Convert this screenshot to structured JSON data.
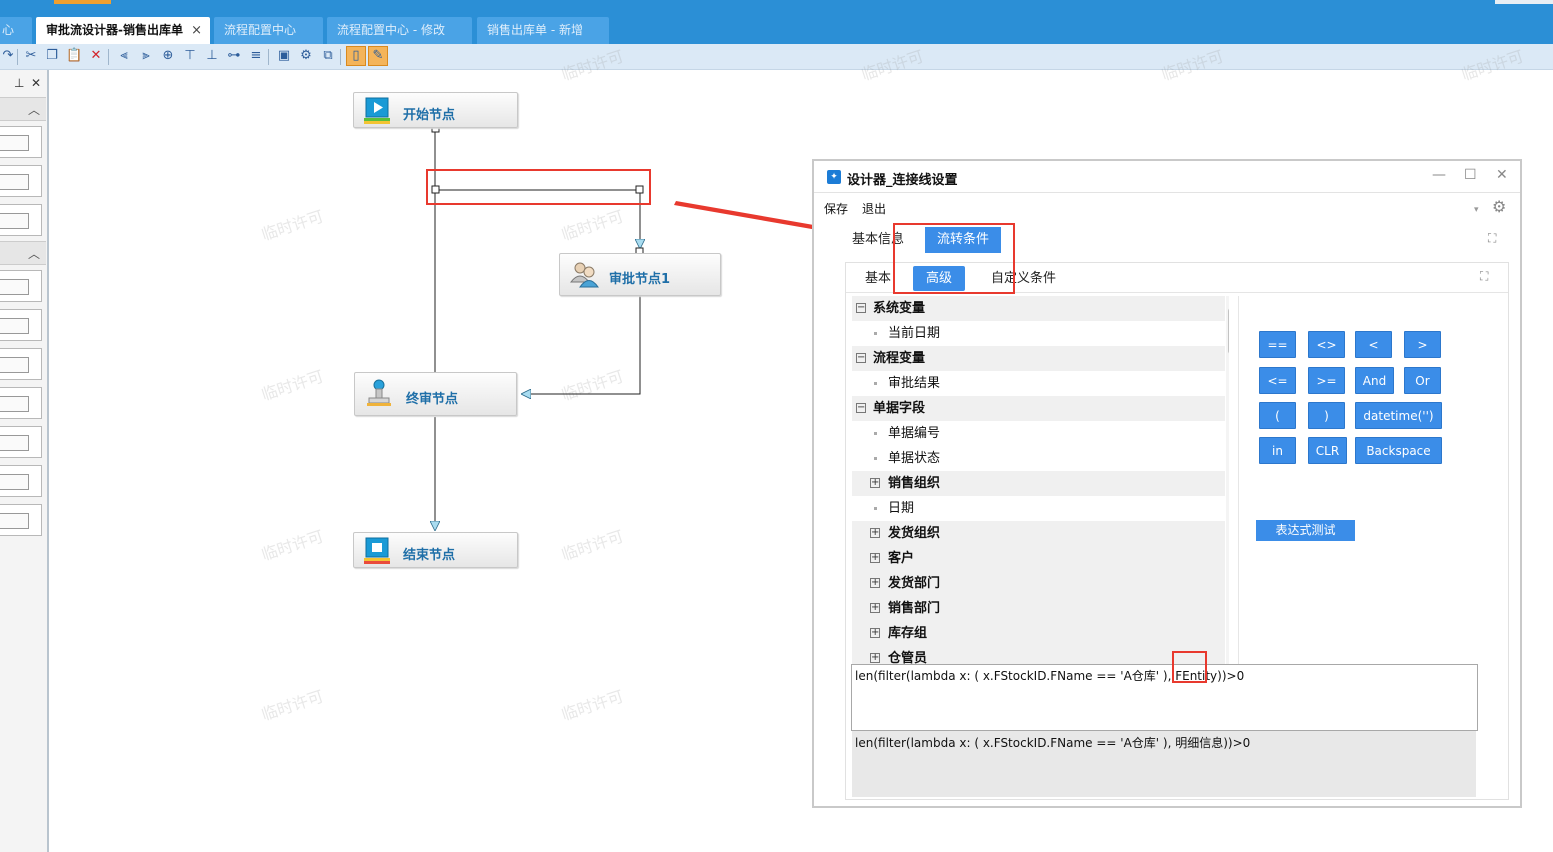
{
  "tabs": [
    {
      "label": "审批流设计器-销售出库单",
      "active": true,
      "closable": true
    },
    {
      "label": "流程配置中心",
      "active": false
    },
    {
      "label": "流程配置中心 - 修改",
      "active": false
    },
    {
      "label": "销售出库单 - 新增",
      "active": false
    }
  ],
  "left_panel": {
    "pin_icon": "↑",
    "close_icon": "×"
  },
  "flow": {
    "nodes": [
      {
        "label": "开始节点",
        "icon": "play-icon"
      },
      {
        "label": "审批节点1",
        "icon": "users-icon"
      },
      {
        "label": "终审节点",
        "icon": "stamp-icon"
      },
      {
        "label": "结束节点",
        "icon": "stop-icon"
      }
    ]
  },
  "watermark": "临时许可",
  "dialog": {
    "title": "设计器_连接线设置",
    "menu": {
      "save": "保存",
      "exit": "退出"
    },
    "tabs": {
      "basic_info": "基本信息",
      "flow_condition": "流转条件"
    },
    "subtabs": {
      "basic": "基本",
      "advanced": "高级",
      "custom": "自定义条件"
    },
    "tree": [
      {
        "type": "group",
        "label": "系统变量",
        "toggle": "−"
      },
      {
        "type": "leaf",
        "label": "当前日期"
      },
      {
        "type": "group",
        "label": "流程变量",
        "toggle": "−"
      },
      {
        "type": "leaf",
        "label": "审批结果"
      },
      {
        "type": "group",
        "label": "单据字段",
        "toggle": "−"
      },
      {
        "type": "leaf",
        "label": "单据编号"
      },
      {
        "type": "leaf",
        "label": "单据状态"
      },
      {
        "type": "sub",
        "label": "销售组织",
        "toggle": "+"
      },
      {
        "type": "leaf",
        "label": "日期"
      },
      {
        "type": "sub",
        "label": "发货组织",
        "toggle": "+"
      },
      {
        "type": "sub",
        "label": "客户",
        "toggle": "+"
      },
      {
        "type": "sub",
        "label": "发货部门",
        "toggle": "+"
      },
      {
        "type": "sub",
        "label": "销售部门",
        "toggle": "+"
      },
      {
        "type": "sub",
        "label": "库存组",
        "toggle": "+"
      },
      {
        "type": "sub",
        "label": "仓管员",
        "toggle": "+"
      }
    ],
    "operators": [
      "==",
      "<>",
      "<",
      ">",
      "<=",
      ">=",
      "And",
      "Or",
      "(",
      ")",
      "datetime('')",
      "in",
      "CLR",
      "Backspace"
    ],
    "test_button": "表达式测试",
    "expression": "len(filter(lambda x: ( x.FStockID.FName == 'A仓库' ), FEntity))>0",
    "expression_preview": "len(filter(lambda x: ( x.FStockID.FName == 'A仓库' ), 明细信息))>0"
  },
  "colors": {
    "accent": "#3b8de8",
    "annotation_red": "#e8392e",
    "node_text": "#1f6fa8",
    "topbar": "#2b8fd6"
  }
}
